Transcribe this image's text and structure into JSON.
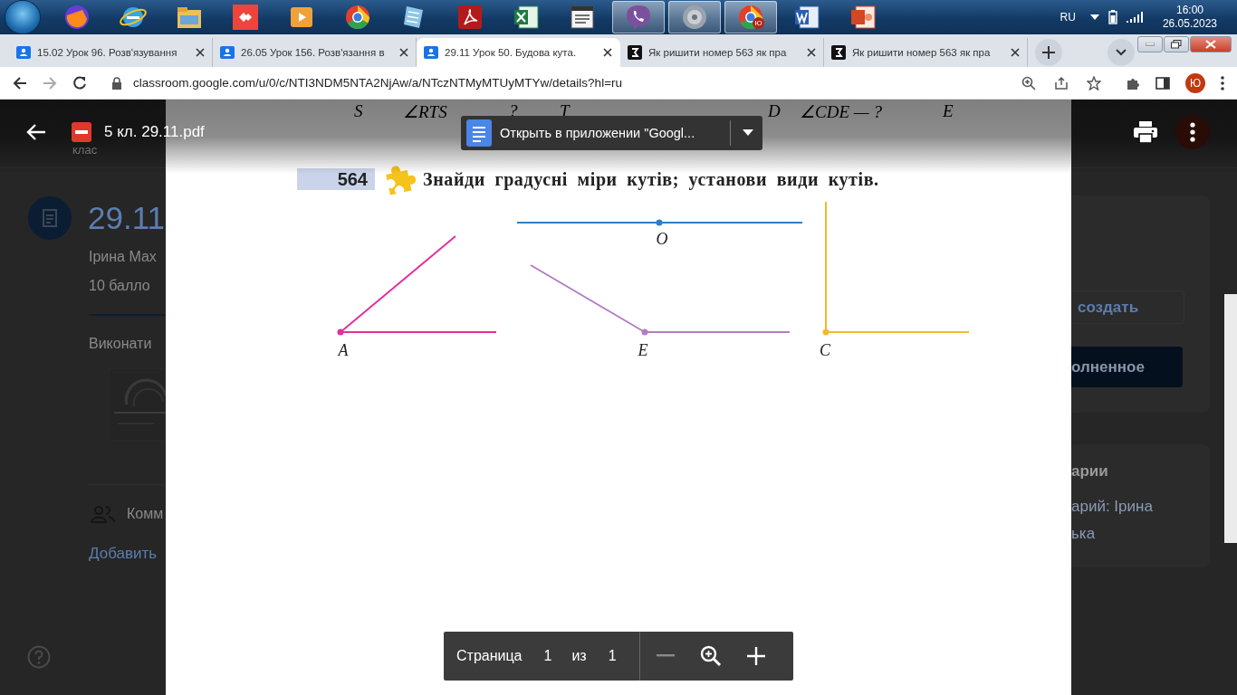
{
  "taskbar": {
    "apps": [
      {
        "kind": "firefox",
        "open": false
      },
      {
        "kind": "ie",
        "open": false
      },
      {
        "kind": "folder",
        "open": false
      },
      {
        "kind": "anydesk",
        "open": false
      },
      {
        "kind": "media",
        "open": false
      },
      {
        "kind": "chrome",
        "open": false
      },
      {
        "kind": "notepad",
        "open": false
      },
      {
        "kind": "pdf",
        "open": false
      },
      {
        "kind": "excel",
        "open": false
      },
      {
        "kind": "window",
        "open": false
      },
      {
        "kind": "viber",
        "open": true
      },
      {
        "kind": "speaker",
        "open": true
      },
      {
        "kind": "chrome",
        "open": true,
        "badge": "Ю"
      },
      {
        "kind": "word",
        "open": false
      },
      {
        "kind": "powerpoint",
        "open": false
      }
    ],
    "language": "RU",
    "time": "16:00",
    "date": "26.05.2023"
  },
  "tabs": [
    {
      "title": "15.02 Урок 96. Розв'язування",
      "kind": "classroom",
      "selected": false
    },
    {
      "title": "26.05 Урок 156. Розв'язання в",
      "kind": "classroom",
      "selected": false
    },
    {
      "title": "29.11 Урок 50. Будова кута.",
      "kind": "classroom",
      "selected": true
    },
    {
      "title": "Як ришити номер 563 як пра",
      "kind": "site",
      "selected": false
    },
    {
      "title": "Як ришити номер 563 як пра",
      "kind": "site",
      "selected": false
    }
  ],
  "address_bar": {
    "url": "classroom.google.com/u/0/c/NTI3NDM5NTA2NjAw/a/NTczNTMyMTUyMTYw/details?hl=ru",
    "avatar": "Ю"
  },
  "background_page": {
    "header_subtitle": "клас",
    "title": "29.11",
    "author": "Ірина Мах",
    "points": "10 балло",
    "instructions": "Виконати",
    "comments_label": "Комм",
    "add_comment": "Добавить",
    "outline_button": "создать",
    "filled_button": "олненное",
    "private_comments_title": "арии",
    "private_comment_lines": [
      "арий: Ірина",
      "ька"
    ]
  },
  "viewer": {
    "file_name": "5 кл. 29.11.pdf",
    "open_with": "Открыть в приложении \"Googl...",
    "page_label": "Страница",
    "page": "1",
    "of": "из",
    "total": "1"
  },
  "pdf_page": {
    "top_labels": [
      "S",
      "∠RTS",
      "?",
      "T",
      "D",
      "∠CDE — ?",
      "E"
    ],
    "exercise_number": "564",
    "task": "Знайди градусні міри кутів; установи види кутів.",
    "point_labels": [
      "A",
      "O",
      "E",
      "C"
    ]
  }
}
